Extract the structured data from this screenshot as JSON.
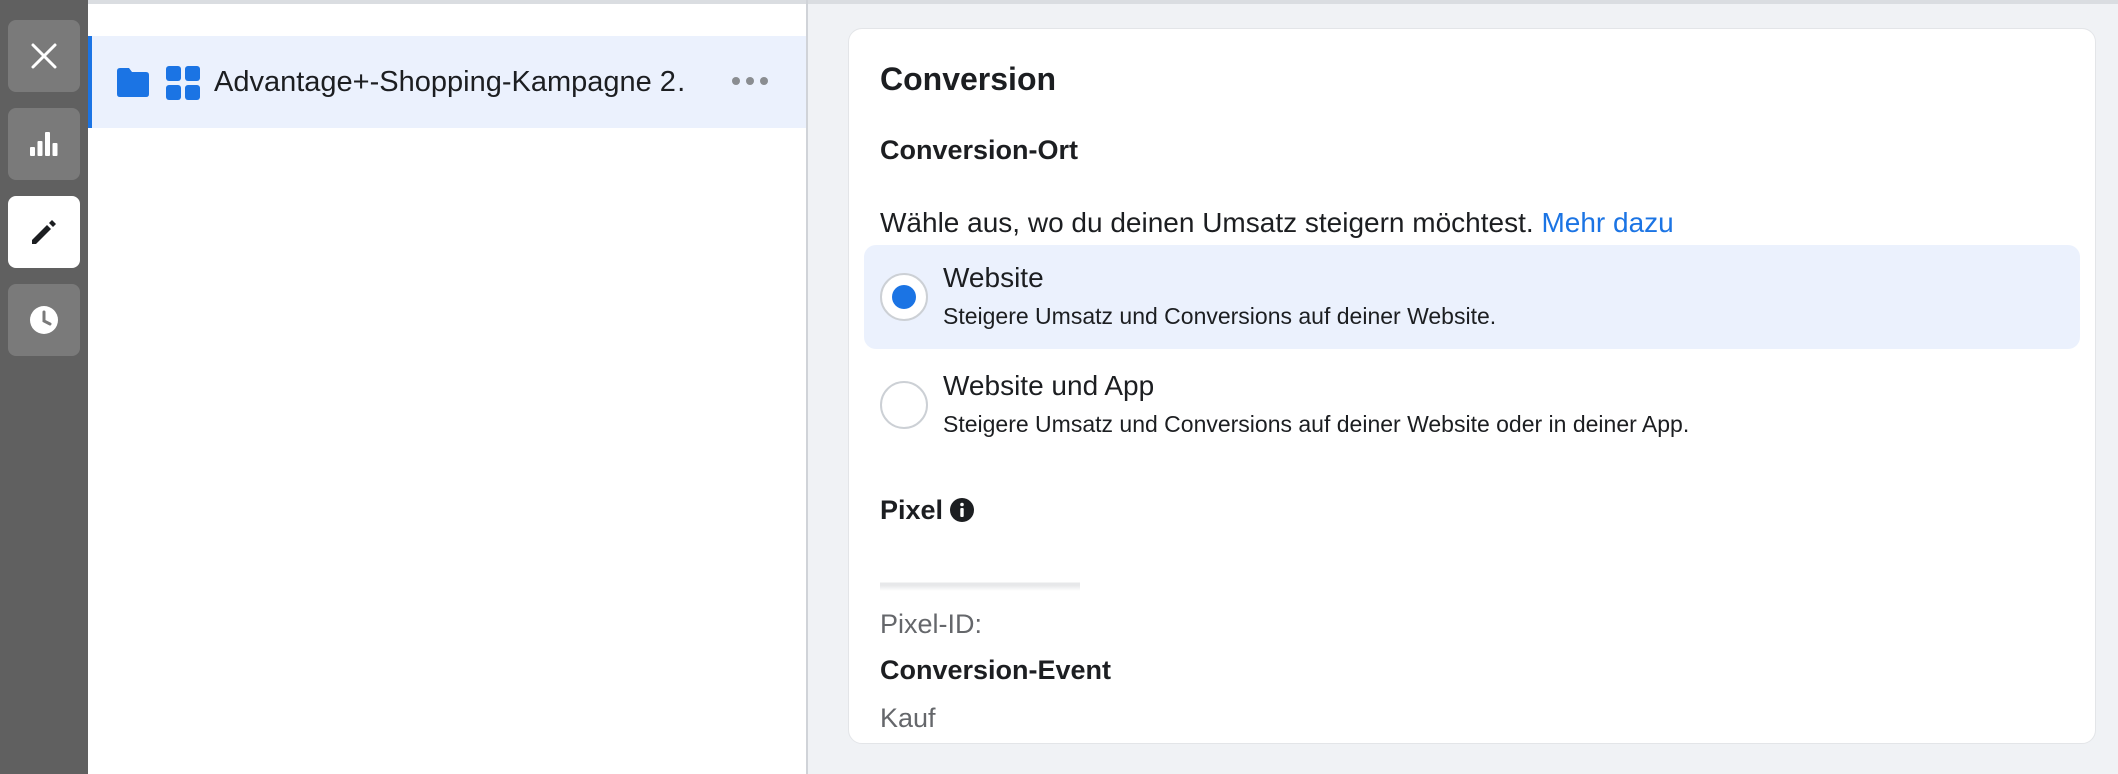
{
  "rail": {
    "buttons": [
      {
        "name": "close",
        "icon": "close-icon",
        "active": false
      },
      {
        "name": "reports",
        "icon": "bar-chart-icon",
        "active": false
      },
      {
        "name": "edit",
        "icon": "pencil-icon",
        "active": true
      },
      {
        "name": "history",
        "icon": "clock-icon",
        "active": false
      }
    ]
  },
  "tree": {
    "item_label": "Advantage+-Shopping-Kampagne 2…",
    "icons": [
      "folder-icon",
      "grid-icon",
      "more-icon"
    ]
  },
  "conversion": {
    "section_title": "Conversion",
    "location_heading": "Conversion-Ort",
    "description": "Wähle aus, wo du deinen Umsatz steigern möchtest.",
    "learn_more_link": "Mehr dazu",
    "options": [
      {
        "title": "Website",
        "description": "Steigere Umsatz und Conversions auf deiner Website.",
        "selected": true
      },
      {
        "title": "Website und App",
        "description": "Steigere Umsatz und Conversions auf deiner Website oder in deiner App.",
        "selected": false
      }
    ],
    "pixel_heading": "Pixel",
    "pixel_id_label": "Pixel-ID:",
    "event_heading": "Conversion-Event",
    "event_value": "Kauf"
  },
  "colors": {
    "accent": "#1b74e4",
    "selected_bg": "#ebf1fd",
    "rail_bg": "#606060"
  }
}
